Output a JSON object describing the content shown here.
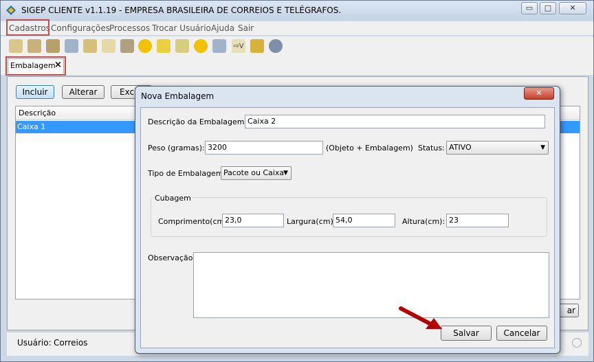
{
  "window": {
    "title": "SIGEP CLIENTE v1.1.19 - EMPRESA BRASILEIRA DE CORREIOS E TELÉGRAFOS.",
    "min": "▭",
    "max": "□",
    "close": "✕"
  },
  "menu": [
    "Cadastros",
    "Configurações",
    "Processos",
    "Trocar Usuário",
    "Ajuda",
    "Sair"
  ],
  "toolbar_icons": [
    "icon-1",
    "icon-2",
    "icon-3",
    "icon-4",
    "icon-5",
    "icon-6",
    "icon-7",
    "icon-8",
    "icon-9",
    "icon-10",
    "icon-11",
    "icon-12",
    "icon-13",
    "icon-14",
    "icon-15"
  ],
  "tab": {
    "label": "Embalagem",
    "close": "×"
  },
  "actions": {
    "incluir": "Incluir",
    "alterar": "Alterar",
    "excluir": "Exclu",
    "gerar": "ar"
  },
  "list": {
    "header": "Descrição",
    "rows": [
      "Caixa 1"
    ]
  },
  "status": {
    "user_label": "Usuário:",
    "user_value": "Correios"
  },
  "dialog": {
    "title": "Nova Embalagem",
    "close": "✕",
    "descricao_label": "Descrição da Embalagem:",
    "descricao_value": "Caixa 2",
    "peso_label": "Peso (gramas):",
    "peso_value": "3200",
    "peso_hint": "(Objeto + Embalagem)",
    "status_label": "Status:",
    "status_value": "ATIVO",
    "tipo_label": "Tipo de Embalagem:",
    "tipo_value": "Pacote ou Caixa",
    "cubagem_label": "Cubagem",
    "comprimento_label": "Comprimento(cm):",
    "comprimento_value": "23,0",
    "largura_label": "Largura(cm):",
    "largura_value": "54,0",
    "altura_label": "Altura(cm):",
    "altura_value": "23",
    "obs_label": "Observação:",
    "obs_value": "",
    "salvar": "Salvar",
    "cancelar": "Cancelar"
  },
  "colors": {
    "selection": "#3399ff",
    "highlight_box": "#c0504d",
    "arrow": "#b30000"
  }
}
